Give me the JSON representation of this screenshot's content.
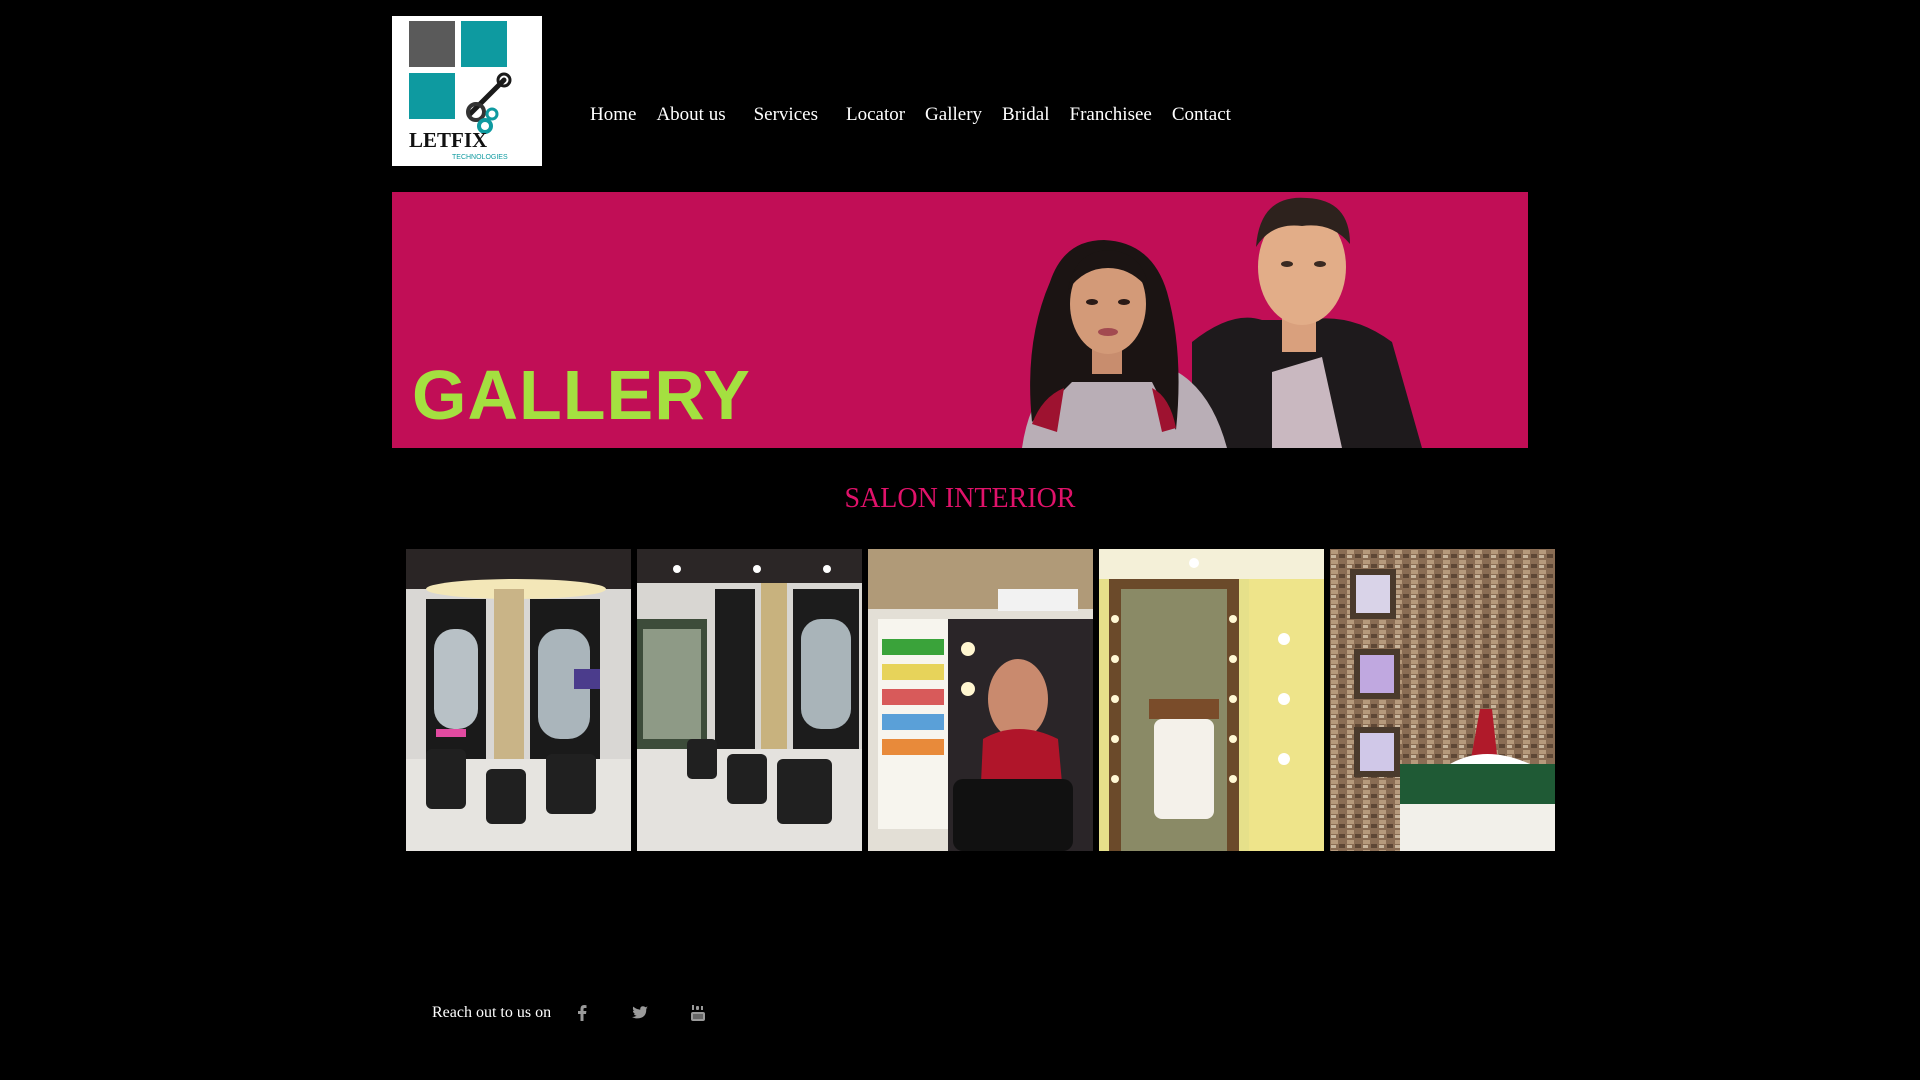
{
  "brand": {
    "logo_text": "LETFIX",
    "logo_subtext": "TECHNOLOGIES",
    "colors": {
      "teal": "#0e9aa0",
      "gray": "#5a5a5a"
    }
  },
  "nav": {
    "items": [
      {
        "label": "Home"
      },
      {
        "label": "About us"
      },
      {
        "label": "Services"
      },
      {
        "label": "Locator"
      },
      {
        "label": "Gallery"
      },
      {
        "label": "Bridal"
      },
      {
        "label": "Franchisee"
      },
      {
        "label": "Contact"
      }
    ]
  },
  "banner": {
    "title": "GALLERY",
    "colors": {
      "background": "#c10e56",
      "title": "#a4e040"
    }
  },
  "section": {
    "title": "SALON INTERIOR",
    "color": "#e0126a"
  },
  "gallery": {
    "photos": [
      {
        "icon": "salon-stations-photo"
      },
      {
        "icon": "salon-chairs-photo"
      },
      {
        "icon": "product-shelf-photo"
      },
      {
        "icon": "vanity-mirror-photo"
      },
      {
        "icon": "treatment-room-photo"
      }
    ]
  },
  "footer": {
    "text": "Reach out to us on",
    "social": [
      {
        "icon": "facebook-icon"
      },
      {
        "icon": "twitter-icon"
      },
      {
        "icon": "youtube-icon"
      }
    ]
  }
}
